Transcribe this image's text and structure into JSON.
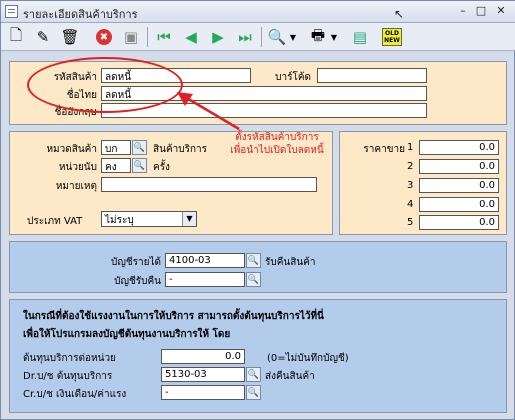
{
  "window": {
    "title": "รายละเอียดสินค้าบริการ"
  },
  "toolbar": {
    "items": [
      {
        "name": "new-icon",
        "glyph": "🗋"
      },
      {
        "name": "edit-icon",
        "glyph": "✎"
      },
      {
        "name": "delete-icon",
        "glyph": "🗑"
      },
      {
        "name": "cancel-icon",
        "glyph": "✖"
      },
      {
        "name": "save-icon",
        "glyph": "💾"
      },
      {
        "name": "first-record-icon",
        "glyph": "⏮"
      },
      {
        "name": "previous-record-icon",
        "glyph": "◀"
      },
      {
        "name": "next-record-icon",
        "glyph": "▶"
      },
      {
        "name": "last-record-icon",
        "glyph": "⏭"
      },
      {
        "name": "search-icon",
        "glyph": "🔍"
      },
      {
        "name": "print-icon",
        "glyph": "🖶"
      },
      {
        "name": "note-icon",
        "glyph": "▤"
      },
      {
        "name": "old-new-icon",
        "glyph": "OLD"
      }
    ]
  },
  "product": {
    "code_label": "รหัสสินค้า",
    "code_value": "ลดหนี้",
    "barcode_label": "บาร์โค้ด",
    "barcode_value": "",
    "thai_name_label": "ชื่อไทย",
    "thai_name_value": "ลดหนี้",
    "english_name_label": "ชื่ออังกฤษ",
    "english_name_value": ""
  },
  "classification": {
    "category_label": "หมวดสินค้า",
    "category_code": "บก",
    "category_name": "สินค้าบริการ",
    "unit_label": "หน่วยนับ",
    "unit_code": "คง",
    "unit_name": "ครั้ง",
    "remark_label": "หมายเหตุ",
    "remark_value": "",
    "vat_label": "ประเภท VAT",
    "vat_value": "ไม่ระบุ"
  },
  "prices": {
    "label": "ราคาขาย",
    "rows": [
      {
        "n": "1",
        "v": "0.0"
      },
      {
        "n": "2",
        "v": "0.0"
      },
      {
        "n": "3",
        "v": "0.0"
      },
      {
        "n": "4",
        "v": "0.0"
      },
      {
        "n": "5",
        "v": "0.0"
      }
    ]
  },
  "accounts": {
    "income_label": "บัญชีรายได้",
    "income_code": "4100-03",
    "income_name": "รับคืนสินค้า",
    "return_label": "บัญชีรับคืน",
    "return_code": "-",
    "return_name": ""
  },
  "service_cost": {
    "note_line1": "ในกรณีที่ต้องใช้แรงงานในการให้บริการ สามารถตั้งต้นทุนบริการไว้ที่นี่",
    "note_line2": "เพื่อให้โปรแกรมลงบัญชีต้นทุนงานบริการให้ โดย",
    "unit_cost_label": "ต้นทุนบริการต่อหน่วย",
    "unit_cost_value": "0.0",
    "unit_cost_hint": "(0=ไม่บันทึกบัญชี)",
    "dr_label": "Dr.บ/ช ต้นทุนบริการ",
    "dr_code": "5130-03",
    "dr_name": "ส่งคืนสินค้า",
    "cr_label": "Cr.บ/ช เงินเดือน/ค่าแรง",
    "cr_code": "-",
    "cr_name": ""
  },
  "annotation": {
    "line1": "ตั้งรหัสสินค้าบริการ",
    "line2": "เพื่อนำไปเปิดใบลดหนี้",
    "color": "#e02020"
  }
}
